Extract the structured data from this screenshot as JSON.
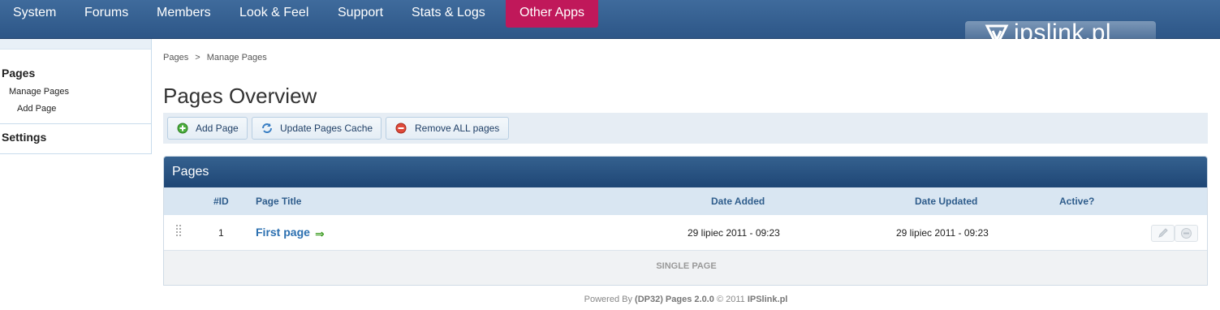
{
  "nav": {
    "items": [
      "System",
      "Forums",
      "Members",
      "Look & Feel",
      "Support",
      "Stats & Logs",
      "Other Apps"
    ],
    "active": "Other Apps"
  },
  "logo": {
    "text": "ipslink.pl"
  },
  "sidebar": {
    "section1": "Pages",
    "links": [
      "Manage Pages",
      "Add Page"
    ],
    "section2": "Settings"
  },
  "breadcrumb": {
    "root": "Pages",
    "sep": ">",
    "current": "Manage Pages"
  },
  "page_title": "Pages Overview",
  "toolbar": {
    "add_label": "Add Page",
    "cache_label": "Update Pages Cache",
    "remove_label": "Remove ALL pages"
  },
  "panel": {
    "title": "Pages",
    "columns": [
      "#ID",
      "Page Title",
      "Date Added",
      "Date Updated",
      "Active?"
    ],
    "rows": [
      {
        "id": "1",
        "title": "First page",
        "added": "29 lipiec 2011 - 09:23",
        "updated": "29 lipiec 2011 - 09:23"
      }
    ],
    "pagination": "SINGLE PAGE"
  },
  "footer": {
    "prefix": "Powered By",
    "product": "(DP32) Pages 2.0.0",
    "copy": "© 2011",
    "owner": "IPSlink.pl"
  },
  "colors": {
    "nav_bg": "#2d5687",
    "active_tab": "#c0185a",
    "link": "#2b6fb0",
    "panel_head": "#1e4675"
  }
}
